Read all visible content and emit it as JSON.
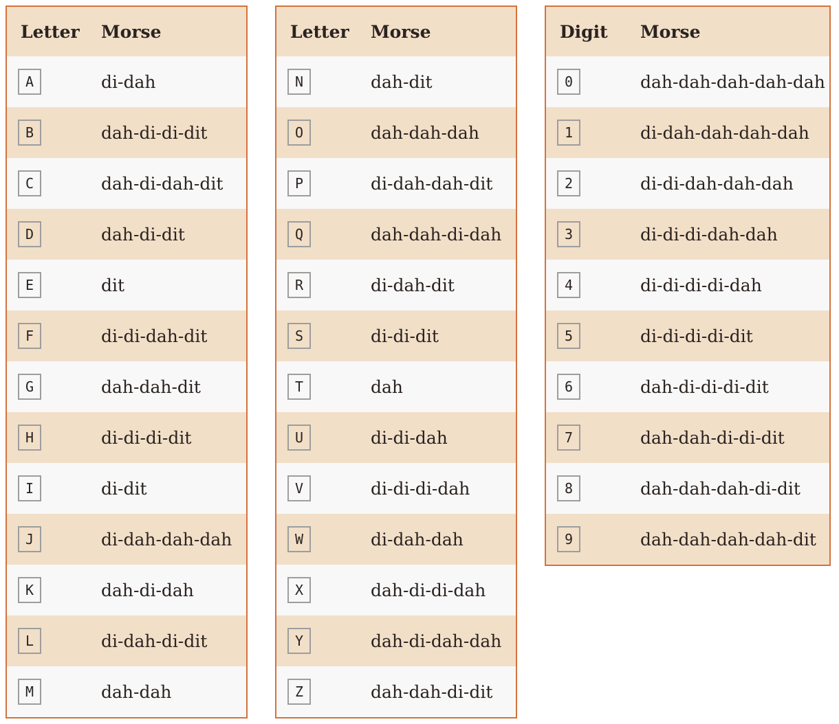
{
  "tables": [
    {
      "headers": [
        "Letter",
        "Morse"
      ],
      "rows": [
        {
          "symbol": "A",
          "morse": "di-dah"
        },
        {
          "symbol": "B",
          "morse": "dah-di-di-dit"
        },
        {
          "symbol": "C",
          "morse": "dah-di-dah-dit"
        },
        {
          "symbol": "D",
          "morse": "dah-di-dit"
        },
        {
          "symbol": "E",
          "morse": "dit"
        },
        {
          "symbol": "F",
          "morse": "di-di-dah-dit"
        },
        {
          "symbol": "G",
          "morse": "dah-dah-dit"
        },
        {
          "symbol": "H",
          "morse": "di-di-di-dit"
        },
        {
          "symbol": "I",
          "morse": "di-dit"
        },
        {
          "symbol": "J",
          "morse": "di-dah-dah-dah"
        },
        {
          "symbol": "K",
          "morse": "dah-di-dah"
        },
        {
          "symbol": "L",
          "morse": "di-dah-di-dit"
        },
        {
          "symbol": "M",
          "morse": "dah-dah"
        }
      ]
    },
    {
      "headers": [
        "Letter",
        "Morse"
      ],
      "rows": [
        {
          "symbol": "N",
          "morse": "dah-dit"
        },
        {
          "symbol": "O",
          "morse": "dah-dah-dah"
        },
        {
          "symbol": "P",
          "morse": "di-dah-dah-dit"
        },
        {
          "symbol": "Q",
          "morse": "dah-dah-di-dah"
        },
        {
          "symbol": "R",
          "morse": "di-dah-dit"
        },
        {
          "symbol": "S",
          "morse": "di-di-dit"
        },
        {
          "symbol": "T",
          "morse": "dah"
        },
        {
          "symbol": "U",
          "morse": "di-di-dah"
        },
        {
          "symbol": "V",
          "morse": "di-di-di-dah"
        },
        {
          "symbol": "W",
          "morse": "di-dah-dah"
        },
        {
          "symbol": "X",
          "morse": "dah-di-di-dah"
        },
        {
          "symbol": "Y",
          "morse": "dah-di-dah-dah"
        },
        {
          "symbol": "Z",
          "morse": "dah-dah-di-dit"
        }
      ]
    },
    {
      "headers": [
        "Digit",
        "Morse"
      ],
      "rows": [
        {
          "symbol": "0",
          "morse": "dah-dah-dah-dah-dah"
        },
        {
          "symbol": "1",
          "morse": "di-dah-dah-dah-dah"
        },
        {
          "symbol": "2",
          "morse": "di-di-dah-dah-dah"
        },
        {
          "symbol": "3",
          "morse": "di-di-di-dah-dah"
        },
        {
          "symbol": "4",
          "morse": "di-di-di-di-dah"
        },
        {
          "symbol": "5",
          "morse": "di-di-di-di-dit"
        },
        {
          "symbol": "6",
          "morse": "dah-di-di-di-dit"
        },
        {
          "symbol": "7",
          "morse": "dah-dah-di-di-dit"
        },
        {
          "symbol": "8",
          "morse": "dah-dah-dah-di-dit"
        },
        {
          "symbol": "9",
          "morse": "dah-dah-dah-dah-dit"
        }
      ]
    }
  ],
  "colors": {
    "border": "#d2733d",
    "header_bg": "#f2dfc8",
    "stripe_bg": "#f2dfc8",
    "row_bg": "#f8f8f8",
    "text": "#2a2320",
    "key_border": "#9d9d9d"
  }
}
